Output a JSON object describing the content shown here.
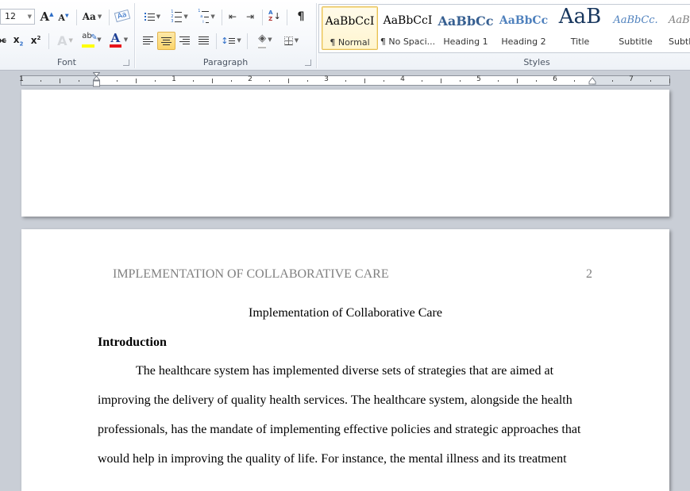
{
  "ribbon": {
    "font_group": {
      "label": "Font",
      "font_size": "12",
      "grow_font_icon": "A",
      "shrink_font_icon": "A",
      "change_case_label": "Aa",
      "partial_strikethrough": "abc",
      "subscript_label": "x",
      "superscript_label": "x",
      "text_effects_label": "A",
      "highlight_label": "ab",
      "font_color_label": "A",
      "highlight_color": "#ffff00",
      "font_color": "#e8141b"
    },
    "paragraph_group": {
      "label": "Paragraph",
      "pilcrow": "¶",
      "sort_top": "A",
      "sort_bottom": "Z"
    },
    "styles_group": {
      "label": "Styles",
      "styles": [
        {
          "preview": "AaBbCcI",
          "name": "¶ Normal",
          "selected": true
        },
        {
          "preview": "AaBbCcI",
          "name": "¶ No Spaci...",
          "selected": false
        },
        {
          "preview": "AaBbCс",
          "name": "Heading 1",
          "selected": false
        },
        {
          "preview": "AaBbCc",
          "name": "Heading 2",
          "selected": false
        },
        {
          "preview": "AaB",
          "name": "Title",
          "selected": false
        },
        {
          "preview": "AaBbCc.",
          "name": "Subtitle",
          "selected": false
        },
        {
          "preview": "AaB",
          "name": "Subtle...",
          "selected": false
        }
      ]
    }
  },
  "ruler": {
    "numbers": [
      "1",
      "1",
      "2",
      "3",
      "4",
      "5",
      "6",
      "7"
    ]
  },
  "document": {
    "page_header": "IMPLEMENTATION OF COLLABORATIVE CARE",
    "page_number": "2",
    "title": "Implementation of Collaborative Care",
    "heading": "Introduction",
    "lines": [
      "The healthcare system has implemented diverse sets of strategies that are aimed at",
      "improving the delivery of quality health services. The healthcare system, alongside the health",
      "professionals, has the mandate of implementing effective policies and strategic approaches that",
      "would help in improving the quality of life. For instance, the mental illness and its treatment"
    ]
  }
}
